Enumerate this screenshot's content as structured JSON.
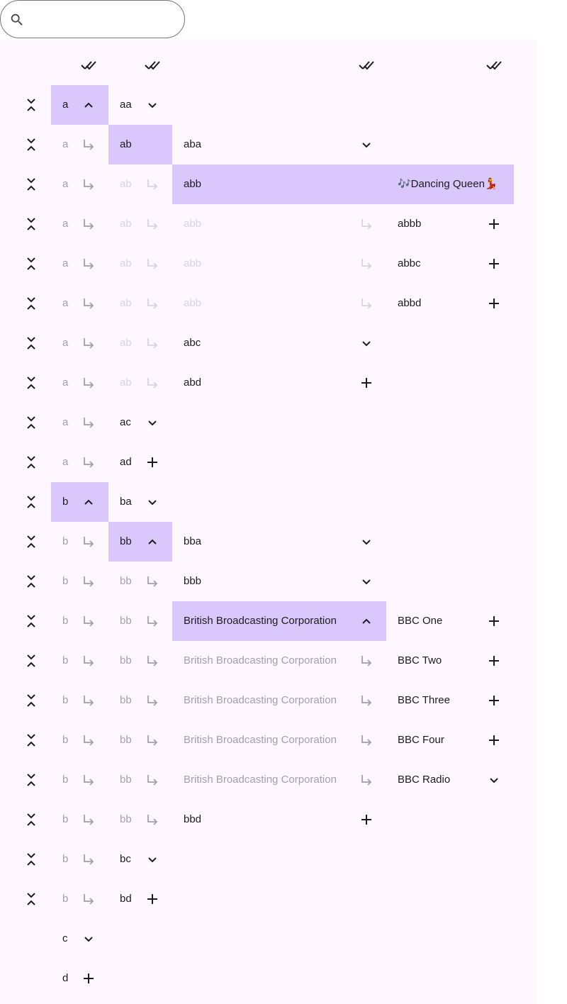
{
  "search": {
    "value": "",
    "placeholder": ""
  },
  "header": {
    "icons": [
      "done-all-icon",
      "done-all-icon",
      "done-all-icon",
      "done-all-icon"
    ]
  },
  "rows": [
    {
      "cells": [
        {
          "col": 0,
          "label": "a",
          "state": "active",
          "icon": "chevron-up",
          "sel": true
        },
        {
          "col": 1,
          "label": "aa",
          "state": "active",
          "icon": "chevron-down"
        }
      ]
    },
    {
      "cells": [
        {
          "col": 0,
          "label": "a",
          "state": "faded",
          "icon": "subdirectory-arrow"
        },
        {
          "col": 1,
          "label": "ab",
          "state": "active",
          "sel": true
        },
        {
          "col": 2,
          "label": "aba",
          "state": "active",
          "icon": "chevron-down"
        }
      ]
    },
    {
      "cells": [
        {
          "col": 0,
          "label": "a",
          "state": "faded",
          "icon": "subdirectory-arrow"
        },
        {
          "col": 1,
          "label": "ab",
          "state": "faint",
          "icon": "subdirectory-arrow"
        },
        {
          "col": 2,
          "label": "abb",
          "state": "active",
          "sel": true,
          "span": true
        },
        {
          "col": 3,
          "label": "🎶Dancing Queen💃",
          "state": "active",
          "sel": true
        }
      ]
    },
    {
      "cells": [
        {
          "col": 0,
          "label": "a",
          "state": "faded",
          "icon": "subdirectory-arrow"
        },
        {
          "col": 1,
          "label": "ab",
          "state": "faint",
          "icon": "subdirectory-arrow"
        },
        {
          "col": 2,
          "label": "abb",
          "state": "faint",
          "icon": "subdirectory-arrow"
        },
        {
          "col": 3,
          "label": "abbb",
          "state": "active",
          "icon": "plus"
        }
      ]
    },
    {
      "cells": [
        {
          "col": 0,
          "label": "a",
          "state": "faded",
          "icon": "subdirectory-arrow"
        },
        {
          "col": 1,
          "label": "ab",
          "state": "faint",
          "icon": "subdirectory-arrow"
        },
        {
          "col": 2,
          "label": "abb",
          "state": "faint",
          "icon": "subdirectory-arrow"
        },
        {
          "col": 3,
          "label": "abbc",
          "state": "active",
          "icon": "plus"
        }
      ]
    },
    {
      "cells": [
        {
          "col": 0,
          "label": "a",
          "state": "faded",
          "icon": "subdirectory-arrow"
        },
        {
          "col": 1,
          "label": "ab",
          "state": "faint",
          "icon": "subdirectory-arrow"
        },
        {
          "col": 2,
          "label": "abb",
          "state": "faint",
          "icon": "subdirectory-arrow"
        },
        {
          "col": 3,
          "label": "abbd",
          "state": "active",
          "icon": "plus"
        }
      ]
    },
    {
      "cells": [
        {
          "col": 0,
          "label": "a",
          "state": "faded",
          "icon": "subdirectory-arrow"
        },
        {
          "col": 1,
          "label": "ab",
          "state": "faint",
          "icon": "subdirectory-arrow"
        },
        {
          "col": 2,
          "label": "abc",
          "state": "active",
          "icon": "chevron-down"
        }
      ]
    },
    {
      "cells": [
        {
          "col": 0,
          "label": "a",
          "state": "faded",
          "icon": "subdirectory-arrow"
        },
        {
          "col": 1,
          "label": "ab",
          "state": "faint",
          "icon": "subdirectory-arrow"
        },
        {
          "col": 2,
          "label": "abd",
          "state": "active",
          "icon": "plus"
        }
      ]
    },
    {
      "cells": [
        {
          "col": 0,
          "label": "a",
          "state": "faded",
          "icon": "subdirectory-arrow"
        },
        {
          "col": 1,
          "label": "ac",
          "state": "active",
          "icon": "chevron-down"
        }
      ]
    },
    {
      "cells": [
        {
          "col": 0,
          "label": "a",
          "state": "faded",
          "icon": "subdirectory-arrow"
        },
        {
          "col": 1,
          "label": "ad",
          "state": "active",
          "icon": "plus"
        }
      ]
    },
    {
      "cells": [
        {
          "col": 0,
          "label": "b",
          "state": "active",
          "icon": "chevron-up",
          "sel": true
        },
        {
          "col": 1,
          "label": "ba",
          "state": "active",
          "icon": "chevron-down"
        }
      ]
    },
    {
      "cells": [
        {
          "col": 0,
          "label": "b",
          "state": "faded",
          "icon": "subdirectory-arrow"
        },
        {
          "col": 1,
          "label": "bb",
          "state": "active",
          "icon": "chevron-up",
          "sel": true
        },
        {
          "col": 2,
          "label": "bba",
          "state": "active",
          "icon": "chevron-down"
        }
      ]
    },
    {
      "cells": [
        {
          "col": 0,
          "label": "b",
          "state": "faded",
          "icon": "subdirectory-arrow"
        },
        {
          "col": 1,
          "label": "bb",
          "state": "faded",
          "icon": "subdirectory-arrow"
        },
        {
          "col": 2,
          "label": "bbb",
          "state": "active",
          "icon": "chevron-down"
        }
      ]
    },
    {
      "cells": [
        {
          "col": 0,
          "label": "b",
          "state": "faded",
          "icon": "subdirectory-arrow"
        },
        {
          "col": 1,
          "label": "bb",
          "state": "faded",
          "icon": "subdirectory-arrow"
        },
        {
          "col": 2,
          "label": "British Broadcasting Corporation",
          "state": "active",
          "icon": "chevron-up",
          "sel": true
        },
        {
          "col": 3,
          "label": "BBC One",
          "state": "active",
          "icon": "plus"
        }
      ]
    },
    {
      "cells": [
        {
          "col": 0,
          "label": "b",
          "state": "faded",
          "icon": "subdirectory-arrow"
        },
        {
          "col": 1,
          "label": "bb",
          "state": "faded",
          "icon": "subdirectory-arrow"
        },
        {
          "col": 2,
          "label": "British Broadcasting Corporation",
          "state": "faded",
          "icon": "subdirectory-arrow"
        },
        {
          "col": 3,
          "label": "BBC Two",
          "state": "active",
          "icon": "plus"
        }
      ]
    },
    {
      "cells": [
        {
          "col": 0,
          "label": "b",
          "state": "faded",
          "icon": "subdirectory-arrow"
        },
        {
          "col": 1,
          "label": "bb",
          "state": "faded",
          "icon": "subdirectory-arrow"
        },
        {
          "col": 2,
          "label": "British Broadcasting Corporation",
          "state": "faded",
          "icon": "subdirectory-arrow"
        },
        {
          "col": 3,
          "label": "BBC Three",
          "state": "active",
          "icon": "plus"
        }
      ]
    },
    {
      "cells": [
        {
          "col": 0,
          "label": "b",
          "state": "faded",
          "icon": "subdirectory-arrow"
        },
        {
          "col": 1,
          "label": "bb",
          "state": "faded",
          "icon": "subdirectory-arrow"
        },
        {
          "col": 2,
          "label": "British Broadcasting Corporation",
          "state": "faded",
          "icon": "subdirectory-arrow"
        },
        {
          "col": 3,
          "label": "BBC Four",
          "state": "active",
          "icon": "plus"
        }
      ]
    },
    {
      "cells": [
        {
          "col": 0,
          "label": "b",
          "state": "faded",
          "icon": "subdirectory-arrow"
        },
        {
          "col": 1,
          "label": "bb",
          "state": "faded",
          "icon": "subdirectory-arrow"
        },
        {
          "col": 2,
          "label": "British Broadcasting Corporation",
          "state": "faded",
          "icon": "subdirectory-arrow"
        },
        {
          "col": 3,
          "label": "BBC Radio",
          "state": "active",
          "icon": "chevron-down"
        }
      ]
    },
    {
      "cells": [
        {
          "col": 0,
          "label": "b",
          "state": "faded",
          "icon": "subdirectory-arrow"
        },
        {
          "col": 1,
          "label": "bb",
          "state": "faded",
          "icon": "subdirectory-arrow"
        },
        {
          "col": 2,
          "label": "bbd",
          "state": "active",
          "icon": "plus"
        }
      ]
    },
    {
      "cells": [
        {
          "col": 0,
          "label": "b",
          "state": "faded",
          "icon": "subdirectory-arrow"
        },
        {
          "col": 1,
          "label": "bc",
          "state": "active",
          "icon": "chevron-down"
        }
      ]
    },
    {
      "cells": [
        {
          "col": 0,
          "label": "b",
          "state": "faded",
          "icon": "subdirectory-arrow"
        },
        {
          "col": 1,
          "label": "bd",
          "state": "active",
          "icon": "plus"
        }
      ]
    },
    {
      "noCollapse": true,
      "cells": [
        {
          "col": 0,
          "label": "c",
          "state": "active",
          "icon": "chevron-down"
        }
      ]
    },
    {
      "noCollapse": true,
      "cells": [
        {
          "col": 0,
          "label": "d",
          "state": "active",
          "icon": "plus"
        }
      ]
    }
  ]
}
